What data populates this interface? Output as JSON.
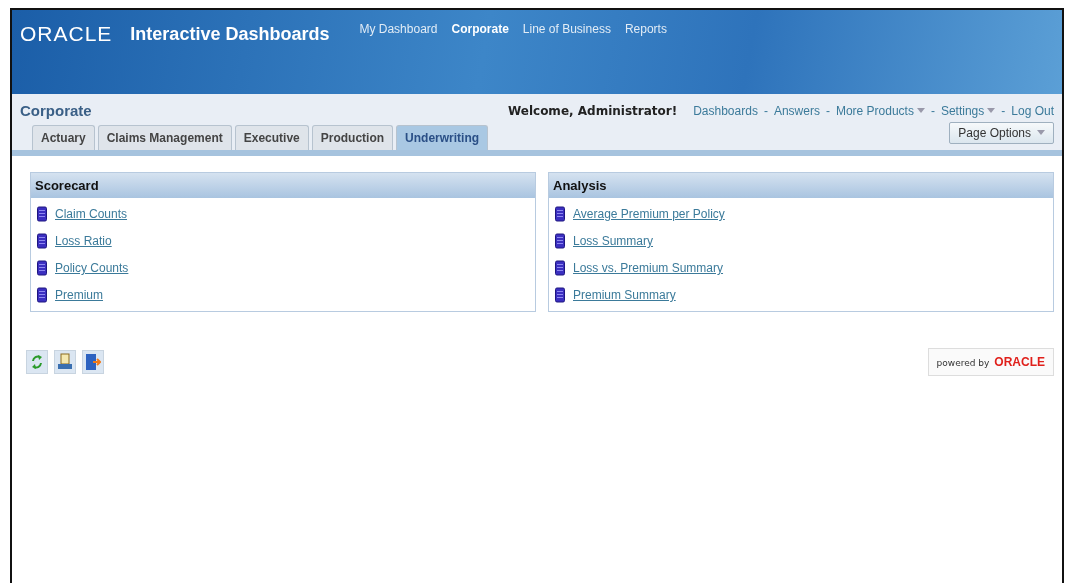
{
  "header": {
    "logo": "ORACLE",
    "title": "Interactive Dashboards",
    "nav": [
      {
        "label": "My Dashboard",
        "selected": false
      },
      {
        "label": "Corporate",
        "selected": true
      },
      {
        "label": "Line of Business",
        "selected": false
      },
      {
        "label": "Reports",
        "selected": false
      }
    ]
  },
  "subheader": {
    "title": "Corporate",
    "welcome": "Welcome, Administrator!",
    "links": [
      {
        "kind": "link",
        "label": "Dashboards",
        "dropdown": false
      },
      {
        "kind": "separator",
        "label": "-"
      },
      {
        "kind": "link",
        "label": "Answers",
        "dropdown": false
      },
      {
        "kind": "separator",
        "label": "-"
      },
      {
        "kind": "link",
        "label": "More Products",
        "dropdown": true
      },
      {
        "kind": "separator",
        "label": "-"
      },
      {
        "kind": "link",
        "label": "Settings",
        "dropdown": true
      },
      {
        "kind": "separator",
        "label": "-"
      },
      {
        "kind": "link",
        "label": "Log Out",
        "dropdown": false
      }
    ],
    "page_options": "Page Options"
  },
  "tabs": [
    {
      "label": "Actuary",
      "selected": false
    },
    {
      "label": "Claims Management",
      "selected": false
    },
    {
      "label": "Executive",
      "selected": false
    },
    {
      "label": "Production",
      "selected": false
    },
    {
      "label": "Underwriting",
      "selected": true
    }
  ],
  "sections": [
    {
      "title": "Scorecard",
      "items": [
        "Claim Counts",
        "Loss Ratio",
        "Policy Counts",
        "Premium"
      ]
    },
    {
      "title": "Analysis",
      "items": [
        "Average Premium per Policy",
        "Loss Summary",
        "Loss vs. Premium Summary",
        "Premium Summary"
      ]
    }
  ],
  "footer": {
    "powered_by": "powered by",
    "brand": "ORACLE"
  }
}
